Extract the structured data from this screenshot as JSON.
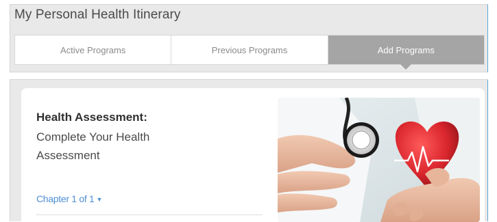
{
  "header": {
    "title": "My Personal Health Itinerary"
  },
  "tabs": [
    {
      "label": "Active Programs",
      "active": false
    },
    {
      "label": "Previous Programs",
      "active": false
    },
    {
      "label": "Add Programs",
      "active": true
    }
  ],
  "card": {
    "heading": "Health Assessment:",
    "subtitle": "Complete Your Health Assessment",
    "chapter_label": "Chapter 1 of 1",
    "chapter_caret_icon": "caret-down-icon",
    "image_icon": "stethoscope-heart-image"
  },
  "colors": {
    "panel_bg": "#e9e9e9",
    "active_tab_bg": "#a5a5a5",
    "link": "#4d8fd6",
    "heart_red": "#d9262d"
  }
}
